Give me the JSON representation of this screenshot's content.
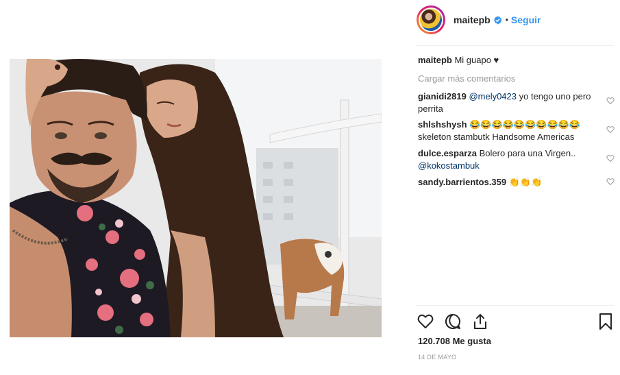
{
  "post": {
    "photo_icon": "selfie-photo",
    "username": "maitepb",
    "separator_dot": "•",
    "follow_label": "Seguir",
    "verified_icon": "verified-badge-icon",
    "caption": {
      "user": "maitepb",
      "text": "Mi guapo ♥"
    },
    "load_more_label": "Cargar más comentarios",
    "comments": [
      {
        "user": "gianidi2819",
        "mention": "@mely0423",
        "text": " yo tengo uno pero perrita"
      },
      {
        "user": "shlshshysh",
        "mention": "",
        "text": " 😂😂😂😂😂😂😂😂😂😂 skeleton stambutk Handsome Americas"
      },
      {
        "user": "dulce.esparza",
        "mention": "",
        "text": " Bolero para una Virgen..",
        "mention_after": "@kokostambuk"
      },
      {
        "user": "sandy.barrientos.359",
        "mention": "",
        "text": " 👏👏👏"
      }
    ],
    "likes": "120.708 Me gusta",
    "date": "14 DE MAYO",
    "accent_color": "#3897f0"
  }
}
